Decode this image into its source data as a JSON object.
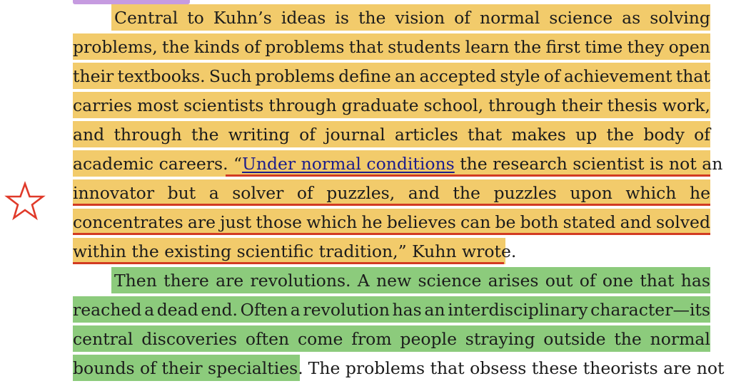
{
  "decoration": {
    "star_icon": "star-outline-icon",
    "colors": {
      "yellow_highlight": "#f2cb6b",
      "green_highlight": "#8ccb7c",
      "red_underline": "#d23b22",
      "purple_tab": "#c69be0",
      "link": "#1d1d8c"
    }
  },
  "paragraph1": {
    "line1": "Central to Kuhn’s ideas is the vision of normal science as solving",
    "line2": "problems, the kinds of problems that students learn the first time they open",
    "line3": "their textbooks. Such problems define an accepted style of achievement that",
    "line4": "carries most scientists through graduate school, through their thesis work,",
    "line5": "and through the writing of journal articles that makes up the body of",
    "line6_pre": "academic careers. “",
    "line6_link": "Under normal conditions",
    "line6_post": " the research scientist is not an",
    "line7": "innovator but a solver of puzzles, and the puzzles upon which he",
    "line8": "concentrates are just those which he believes can be both stated and solved",
    "line9": "within the existing scientific tradition,” Kuhn wrote."
  },
  "paragraph2": {
    "line1": "Then there are revolutions. A new science arises out of one that has",
    "line2": "reached a dead end. Often a revolution has an interdisciplinary character—its",
    "line3": "central discoveries often come from people straying outside the normal",
    "line4_highlighted": "bounds of their specialties.",
    "line4_rest": "The problems that obsess these theorists are not"
  }
}
